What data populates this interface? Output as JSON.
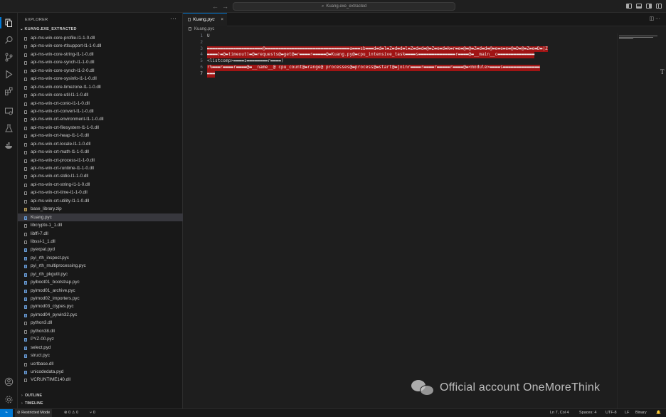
{
  "titlebar": {
    "nav_back": "←",
    "nav_forward": "→",
    "search_icon": "⌕",
    "search_text": "Kuang.exe_extracted"
  },
  "activity": {
    "items": [
      "explorer-icon",
      "search-icon",
      "source-control-icon",
      "run-debug-icon",
      "extensions-icon",
      "remote-explorer-icon",
      "testing-icon",
      "docker-icon"
    ],
    "bottom": [
      "account-icon",
      "manage-gear-icon"
    ]
  },
  "explorer": {
    "title": "EXPLORER",
    "more": "···",
    "folder": "KUANG.EXE_EXTRACTED",
    "files": [
      "api-ms-win-core-profile-l1-1-0.dll",
      "api-ms-win-core-rtlsupport-l1-1-0.dll",
      "api-ms-win-core-string-l1-1-0.dll",
      "api-ms-win-core-synch-l1-1-0.dll",
      "api-ms-win-core-synch-l1-2-0.dll",
      "api-ms-win-core-sysinfo-l1-1-0.dll",
      "api-ms-win-core-timezone-l1-1-0.dll",
      "api-ms-win-core-util-l1-1-0.dll",
      "api-ms-win-crt-conio-l1-1-0.dll",
      "api-ms-win-crt-convert-l1-1-0.dll",
      "api-ms-win-crt-environment-l1-1-0.dll",
      "api-ms-win-crt-filesystem-l1-1-0.dll",
      "api-ms-win-crt-heap-l1-1-0.dll",
      "api-ms-win-crt-locale-l1-1-0.dll",
      "api-ms-win-crt-math-l1-1-0.dll",
      "api-ms-win-crt-process-l1-1-0.dll",
      "api-ms-win-crt-runtime-l1-1-0.dll",
      "api-ms-win-crt-stdio-l1-1-0.dll",
      "api-ms-win-crt-string-l1-1-0.dll",
      "api-ms-win-crt-time-l1-1-0.dll",
      "api-ms-win-crt-utility-l1-1-0.dll",
      "base_library.zip",
      "Kuang.pyc",
      "libcrypto-1_1.dll",
      "libffi-7.dll",
      "libssl-1_1.dll",
      "pyexpat.pyd",
      "pyi_rth_inspect.pyc",
      "pyi_rth_multiprocessing.pyc",
      "pyi_rth_pkgutil.pyc",
      "pyiboot01_bootstrap.pyc",
      "pyimod01_archive.pyc",
      "pyimod02_importers.pyc",
      "pyimod03_ctypes.pyc",
      "pyimod04_pywin32.pyc",
      "python3.dll",
      "python38.dll",
      "PYZ-00.pyz",
      "select.pyd",
      "struct.pyc",
      "ucrtbase.dll",
      "unicodedata.pyd",
      "VCRUNTIME140.dll"
    ],
    "selected_index": 22,
    "outline_label": "OUTLINE",
    "timeline_label": "TIMELINE",
    "chevron": "›"
  },
  "editor": {
    "tab_label": "Kuang.pyc",
    "tab_close": "×",
    "tab_actions": "◫  ···",
    "breadcrumb": "Kuang.pyc",
    "lines": [
      {
        "num": "1",
        "text": "U"
      },
      {
        "num": "2",
        "text": ""
      },
      {
        "num": "3",
        "text": "▬▬▬▬▬▬▬▬▬▬▬▬▬▬▬▬▬▬▬▬▬@▬▬▬▬▬▬▬▬▬▬▬▬▬▬▬▬▬▬▬▬▬▬▬▬▬▬▬▬▬▬▬▬a▬▬▬sb▬▬▬d▬d▬l▬Z▬d▬d▬l▬Z▬d▬d▬@▬Z▬e▬d▬k▬r▬e▬@▬@▬Z▬d▬d▬@▬e▬e▬e▬@▬D▬@▬Z▬e▬D▬|Z"
      },
      {
        "num": "4",
        "text": "▬▬▬▬)▬@▬timeout)▬@▬requests@▬get@▬r▬▬▬▬r▬▬▬▬▬@▬Kuang.py@▬cpu_intensive_task▬▬▬▬s▬▬▬▬▬▬▬▬▬▬▬▬▬▬r▬▬▬▬@▬__main__c▬▬▬▬▬▬▬▬▬▬▬▬▬▬"
      },
      {
        "num": "5",
        "text": "<listcomp>▬▬▬▬s▬▬▬▬▬▬▬▬r▬▬▬▬)"
      },
      {
        "num": "6",
        "text": "r%▬▬▬r▬▬▬▬r▬▬▬▬@▬__name__@  cpu_count@▬range@   processes@▬process@▬start@▬joinr▬▬▬▬r▬▬▬▬r▬▬▬▬▬r▬▬▬▬@▬<module>▬▬▬▬s▬▬▬▬▬▬▬▬▬▬▬▬▬▬"
      },
      {
        "num": "7",
        "text": "▬▬▬"
      }
    ],
    "current_line": "7",
    "stray_char": "T"
  },
  "statusbar": {
    "remote_icon": "⌁",
    "restricted": "⊘ Restricted Mode",
    "problems": "⊗ 0 ⚠ 0",
    "ports": "⑂ 0",
    "position": "Ln 7, Col 4",
    "spaces": "Spaces: 4",
    "encoding": "UTF-8",
    "eol": "LF",
    "language": "Binary",
    "bell": "🔔"
  },
  "watermark": {
    "text": "Official account OneMoreThink"
  },
  "colors": {
    "accent": "#0078d4",
    "highlight": "#a01414"
  }
}
